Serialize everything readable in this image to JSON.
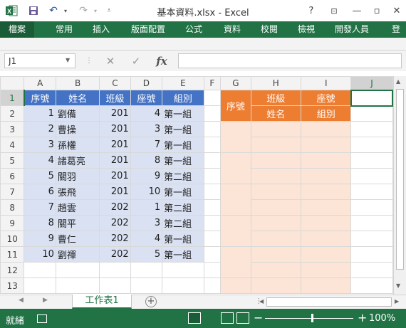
{
  "window": {
    "title": "基本資料.xlsx - Excel",
    "help_label": "?",
    "min_label": "—",
    "close_label": "✕"
  },
  "ribbon": {
    "tabs": [
      "檔案",
      "常用",
      "插入",
      "版面配置",
      "公式",
      "資料",
      "校閱",
      "檢視",
      "開發人員",
      "登"
    ]
  },
  "formula_bar": {
    "name_box": "J1",
    "formula": "",
    "fx_label": "fx"
  },
  "sheet": {
    "columns": [
      "A",
      "B",
      "C",
      "D",
      "E",
      "F",
      "G",
      "H",
      "I",
      "J"
    ],
    "selected_column": "J",
    "rows": [
      "1",
      "2",
      "3",
      "4",
      "5",
      "6",
      "7",
      "8",
      "9",
      "10",
      "11",
      "12",
      "13"
    ],
    "selected_row": "1",
    "table_headers": [
      "序號",
      "姓名",
      "班級",
      "座號",
      "組別"
    ],
    "table_rows": [
      [
        "1",
        "劉備",
        "201",
        "4",
        "第一組"
      ],
      [
        "2",
        "曹操",
        "201",
        "3",
        "第一組"
      ],
      [
        "3",
        "孫權",
        "201",
        "7",
        "第一組"
      ],
      [
        "4",
        "諸葛亮",
        "201",
        "8",
        "第一組"
      ],
      [
        "5",
        "關羽",
        "201",
        "9",
        "第二組"
      ],
      [
        "6",
        "張飛",
        "201",
        "10",
        "第一組"
      ],
      [
        "7",
        "趙雲",
        "202",
        "1",
        "第二組"
      ],
      [
        "8",
        "關平",
        "202",
        "3",
        "第二組"
      ],
      [
        "9",
        "曹仁",
        "202",
        "4",
        "第一組"
      ],
      [
        "10",
        "劉禪",
        "202",
        "5",
        "第一組"
      ]
    ],
    "form_header": {
      "seq": "序號",
      "class": "班級",
      "seat": "座號",
      "name": "姓名",
      "group": "組別"
    }
  },
  "sheet_tabs": {
    "active": "工作表1",
    "add_label": "+"
  },
  "status": {
    "ready": "就緒",
    "zoom": "100%",
    "zoom_minus": "−",
    "zoom_plus": "+"
  },
  "colors": {
    "excel_green": "#217346",
    "header_blue": "#4472c4",
    "data_blue": "#d9e1f2",
    "header_orange": "#ed7d31",
    "peach": "#fce4d6"
  }
}
